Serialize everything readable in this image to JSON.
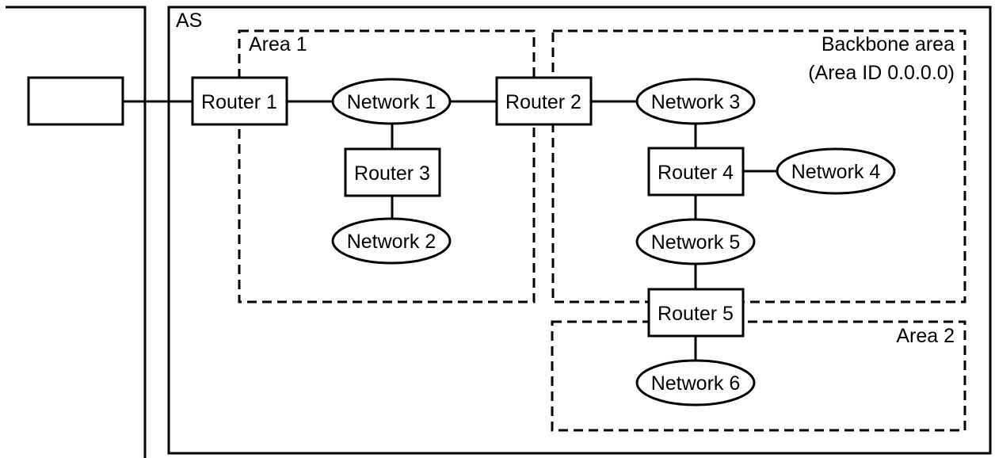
{
  "diagram": {
    "as_label": "AS",
    "areas": [
      {
        "id": "area1",
        "label": "Area 1"
      },
      {
        "id": "backbone",
        "label_line1": "Backbone area",
        "label_line2": "(Area ID 0.0.0.0)"
      },
      {
        "id": "area2",
        "label": "Area 2"
      }
    ],
    "external_box_label": "",
    "routers": [
      {
        "id": "router1",
        "label": "Router 1"
      },
      {
        "id": "router2",
        "label": "Router 2"
      },
      {
        "id": "router3",
        "label": "Router 3"
      },
      {
        "id": "router4",
        "label": "Router 4"
      },
      {
        "id": "router5",
        "label": "Router 5"
      }
    ],
    "networks": [
      {
        "id": "network1",
        "label": "Network 1"
      },
      {
        "id": "network2",
        "label": "Network 2"
      },
      {
        "id": "network3",
        "label": "Network 3"
      },
      {
        "id": "network4",
        "label": "Network 4"
      },
      {
        "id": "network5",
        "label": "Network 5"
      },
      {
        "id": "network6",
        "label": "Network 6"
      }
    ],
    "links": [
      [
        "external",
        "router1"
      ],
      [
        "router1",
        "network1"
      ],
      [
        "network1",
        "router2"
      ],
      [
        "network1",
        "router3"
      ],
      [
        "router3",
        "network2"
      ],
      [
        "router2",
        "network3"
      ],
      [
        "network3",
        "router4"
      ],
      [
        "router4",
        "network4"
      ],
      [
        "router4",
        "network5"
      ],
      [
        "network5",
        "router5"
      ],
      [
        "router5",
        "network6"
      ]
    ]
  }
}
